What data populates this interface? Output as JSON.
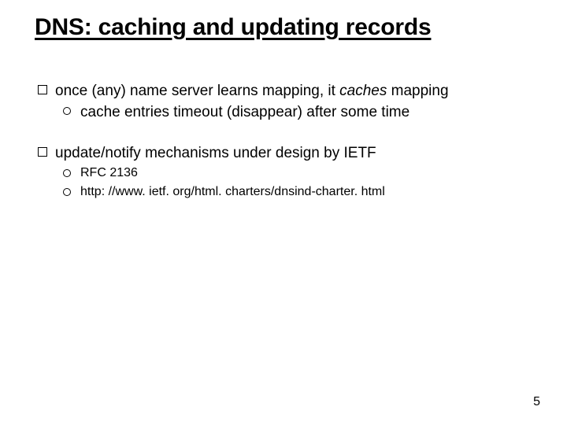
{
  "title": "DNS: caching and updating records",
  "bullets": [
    {
      "html": "once (any) name server learns mapping, it <i>caches</i> mapping",
      "subs": [
        {
          "html": "cache entries timeout (disappear) after some time",
          "cls": "sub-normal"
        }
      ]
    },
    {
      "html": "update/notify mechanisms under design by IETF",
      "subs": [
        {
          "html": "RFC 2136",
          "cls": "sub-small"
        },
        {
          "html": "http: //www. ietf. org/html. charters/dnsind-charter. html",
          "cls": "sub-small"
        }
      ]
    }
  ],
  "page_number": "5"
}
